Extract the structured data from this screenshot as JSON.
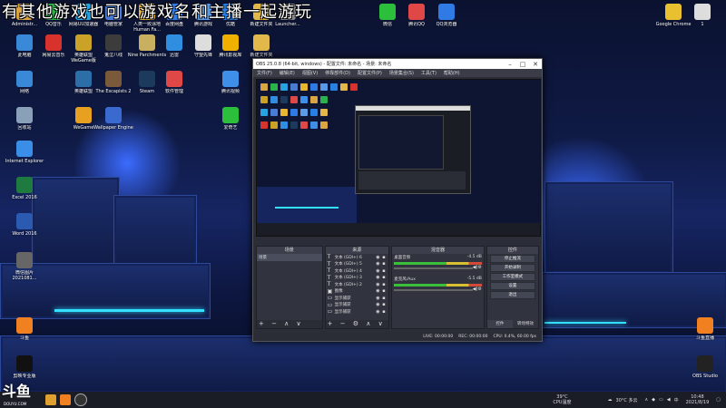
{
  "overlay": {
    "text": "有其他游戏也可以游戏名和主播一起游玩"
  },
  "watermark": {
    "brand": "斗鱼",
    "sub": "DOUYU.COM"
  },
  "desktop": {
    "left_icons": [
      {
        "name": "admin-icon",
        "label": "Administr...",
        "color": "#d9a441"
      },
      {
        "name": "qq-music-icon",
        "label": "QQ音乐",
        "color": "#2bb24c"
      },
      {
        "name": "netease-uu-icon",
        "label": "网易UU加速器",
        "color": "#26a3e0"
      },
      {
        "name": "game-icon-1",
        "label": "电脑管家",
        "color": "#4a7bd4"
      },
      {
        "name": "humanfall-icon",
        "label": "人类一败涂地 Human Fa...",
        "color": "#e8b530"
      },
      {
        "name": "baidu-disk-icon",
        "label": "百度网盘",
        "color": "#2f7ae5"
      },
      {
        "name": "tencent-icon",
        "label": "腾讯游戏",
        "color": "#5b9be6"
      },
      {
        "name": "vtuber-icon",
        "label": "优酷",
        "color": "#2780e3"
      },
      {
        "name": "folder-icon",
        "label": "新建文件夹",
        "color": "#e2b84a"
      },
      {
        "name": "launcher-icon",
        "label": "Launcher...",
        "color": "#888888"
      },
      {
        "name": "this-pc-icon",
        "label": "此电脑",
        "color": "#3a88d8"
      },
      {
        "name": "netease-music-icon",
        "label": "网易云音乐",
        "color": "#d8322c"
      },
      {
        "name": "wegame-icon",
        "label": "英雄联盟 WeGame版",
        "color": "#c9a227"
      },
      {
        "name": "ai-icon",
        "label": "鬼泣八线",
        "color": "#3c3c3c"
      },
      {
        "name": "nine-parchments-icon",
        "label": "Nine Parchments",
        "color": "#c9b060"
      },
      {
        "name": "flight-icon",
        "label": "迅雷",
        "color": "#2f8ee0"
      },
      {
        "name": "headset-icon",
        "label": "守望先锋",
        "color": "#dddddd"
      },
      {
        "name": "tencent-video-icon",
        "label": "腾讯影视库",
        "color": "#f0b000"
      },
      {
        "name": "new-folder-icon",
        "label": "新建文件夹",
        "color": "#e2b84a"
      },
      {
        "name": "network-icon",
        "label": "网络",
        "color": "#3a88d8"
      },
      {
        "name": "lol-icon",
        "label": "英雄联盟",
        "color": "#2b6ea8"
      },
      {
        "name": "escapists-icon",
        "label": "The Escapists 2",
        "color": "#7a5a3a"
      },
      {
        "name": "steam-icon",
        "label": "Steam",
        "color": "#1b3a5c"
      },
      {
        "name": "software-icon",
        "label": "软件管理",
        "color": "#e04848"
      },
      {
        "name": "tencent-video2-icon",
        "label": "腾讯视频",
        "color": "#3f8ee8"
      },
      {
        "name": "recycle-icon",
        "label": "回收站",
        "color": "#8aa0b8"
      },
      {
        "name": "wegame2-icon",
        "label": "WeGame",
        "color": "#e8a020"
      },
      {
        "name": "wallpaper-icon",
        "label": "Wallpaper Engine",
        "color": "#3a6ad0"
      },
      {
        "name": "iqiyi-icon",
        "label": "爱奇艺",
        "color": "#2bbf3b"
      },
      {
        "name": "ie-icon",
        "label": "Internet Explorer",
        "color": "#3a8ee8"
      },
      {
        "name": "excel-icon",
        "label": "Excel 2016",
        "color": "#1f7a3f"
      },
      {
        "name": "word-icon",
        "label": "Word 2016",
        "color": "#2a5bb0"
      },
      {
        "name": "screenshot-icon",
        "label": "微信图片 2021081...",
        "color": "#666666"
      },
      {
        "name": "douyu-icon",
        "label": "斗鱼",
        "color": "#f08020"
      },
      {
        "name": "capcut-icon",
        "label": "剪映专业版",
        "color": "#111111"
      }
    ],
    "right_icons": [
      {
        "name": "wechat-icon",
        "label": "微信",
        "color": "#2bbf3b"
      },
      {
        "name": "tencent-qq-icon",
        "label": "腾讯QQ",
        "color": "#e04848"
      },
      {
        "name": "qq-browser-icon",
        "label": "QQ浏览器",
        "color": "#2f7ae5"
      },
      {
        "name": "chrome-icon",
        "label": "Google Chrome",
        "color": "#e8c030"
      },
      {
        "name": "file-icon",
        "label": "1",
        "color": "#dddddd"
      },
      {
        "name": "douyu-live-icon",
        "label": "斗鱼直播",
        "color": "#f08020"
      },
      {
        "name": "obs-studio-icon",
        "label": "OBS Studio",
        "color": "#222222"
      }
    ]
  },
  "obs": {
    "title": "OBS 25.0.8 (64-bit, windows) - 配置文件: 未命名 - 场景: 未命名",
    "menu": [
      "文件(F)",
      "编辑(E)",
      "视图(V)",
      "停靠部件(D)",
      "配置文件(P)",
      "场景集合(S)",
      "工具(T)",
      "帮助(H)"
    ],
    "docks": {
      "scenes": {
        "title": "场景",
        "items": [
          "场景"
        ]
      },
      "sources": {
        "title": "来源",
        "items": [
          {
            "type": "T",
            "name": "文本 (GDI+) 6"
          },
          {
            "type": "T",
            "name": "文本 (GDI+) 5"
          },
          {
            "type": "T",
            "name": "文本 (GDI+) 4"
          },
          {
            "type": "T",
            "name": "文本 (GDI+) 3"
          },
          {
            "type": "T",
            "name": "文本 (GDI+) 2"
          },
          {
            "type": "img",
            "name": "图像"
          },
          {
            "type": "cam",
            "name": "显示捕获"
          },
          {
            "type": "cam",
            "name": "显示捕获"
          },
          {
            "type": "cam",
            "name": "显示捕获"
          }
        ]
      },
      "mixer": {
        "title": "混音器",
        "channels": [
          {
            "name": "桌面音频",
            "db": "-4.5 dB"
          },
          {
            "name": "麦克风/Aux",
            "db": "-5.5 dB"
          }
        ]
      },
      "controls": {
        "title": "控件",
        "buttons": [
          "停止推流",
          "开始录制",
          "工作室模式",
          "设置",
          "退出"
        ]
      }
    },
    "bottom_tabs": [
      "控件",
      "转场特效"
    ],
    "status": {
      "live": "LIVE: 00:00:00",
      "rec": "REC: 00:00:00",
      "cpu": "CPU: 0.4%, 60.00 fps"
    }
  },
  "taskbar": {
    "temp": "39°C",
    "temp_label": "CPU温度",
    "weather": "30°C 多云",
    "lang": "中",
    "time": "10:48",
    "date": "2021/8/19"
  }
}
